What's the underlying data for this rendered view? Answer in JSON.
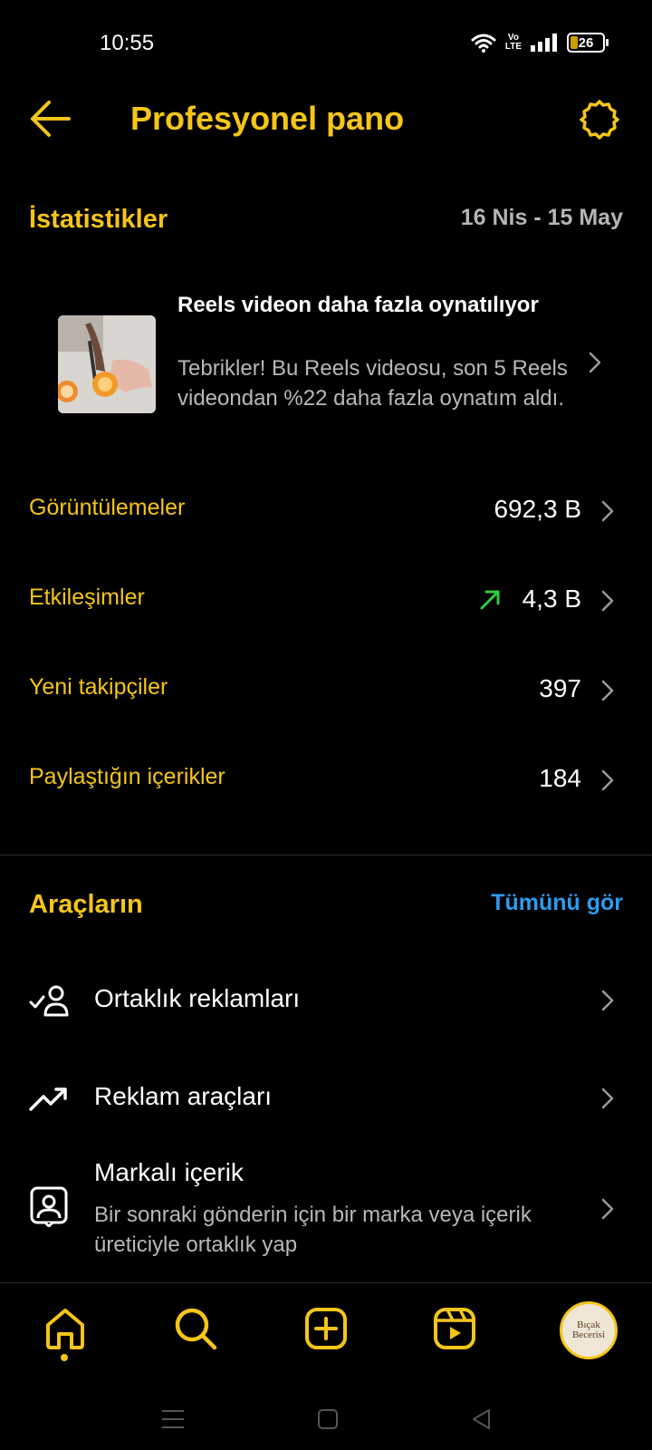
{
  "status_bar": {
    "time": "10:55",
    "network_label_top": "Vo",
    "network_label_bottom": "LTE",
    "battery": "26"
  },
  "header": {
    "title": "Profesyonel pano"
  },
  "stats": {
    "title": "İstatistikler",
    "date_range": "16 Nis - 15 May",
    "highlight": {
      "title": "Reels videon daha fazla oynatılıyor",
      "description": "Tebrikler! Bu Reels videosu, son 5 Reels videondan %22 daha fazla oynatım aldı."
    },
    "rows": [
      {
        "label": "Görüntülemeler",
        "value": "692,3 B"
      },
      {
        "label": "Etkileşimler",
        "value": "4,3 B",
        "trend": "up",
        "trend_color": "#2ecc40"
      },
      {
        "label": "Yeni takipçiler",
        "value": "397"
      },
      {
        "label": "Paylaştığın içerikler",
        "value": "184"
      }
    ]
  },
  "tools": {
    "title": "Araçların",
    "see_all": "Tümünü gör",
    "items": [
      {
        "label": "Ortaklık reklamları",
        "icon": "partnership-icon"
      },
      {
        "label": "Reklam araçları",
        "icon": "trending-icon"
      },
      {
        "label": "Markalı içerik",
        "description": "Bir sonraki gönderin için bir marka veya içerik üreticiyle ortaklık yap",
        "icon": "branded-content-icon"
      }
    ]
  },
  "bottom_nav": {
    "items": [
      "home-icon",
      "search-icon",
      "create-icon",
      "reels-icon",
      "profile-avatar"
    ],
    "avatar_text_1": "Bıçak",
    "avatar_text_2": "Becerisi"
  },
  "colors": {
    "accent": "#f5c518",
    "link": "#2e9bf0",
    "muted": "#b8b8b8",
    "background": "#000000"
  }
}
